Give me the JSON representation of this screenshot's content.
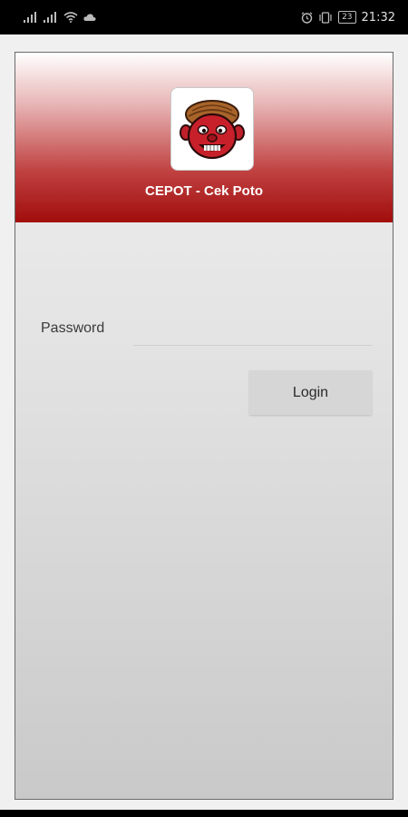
{
  "status_bar": {
    "time": "21:32",
    "battery": "23",
    "icons": [
      "signal-icon",
      "signal-icon",
      "wifi-icon",
      "cloud-icon",
      "alarm-icon",
      "vibrate-icon",
      "battery-icon"
    ]
  },
  "header": {
    "title": "CEPOT - Cek Poto",
    "logo": "cepot-character-logo"
  },
  "form": {
    "password_label": "Password",
    "password_value": "",
    "login_label": "Login"
  },
  "colors": {
    "header_gradient_top": "#ffffff",
    "header_gradient_bottom": "#a10c0c",
    "button_bg": "#d6d6d6"
  }
}
